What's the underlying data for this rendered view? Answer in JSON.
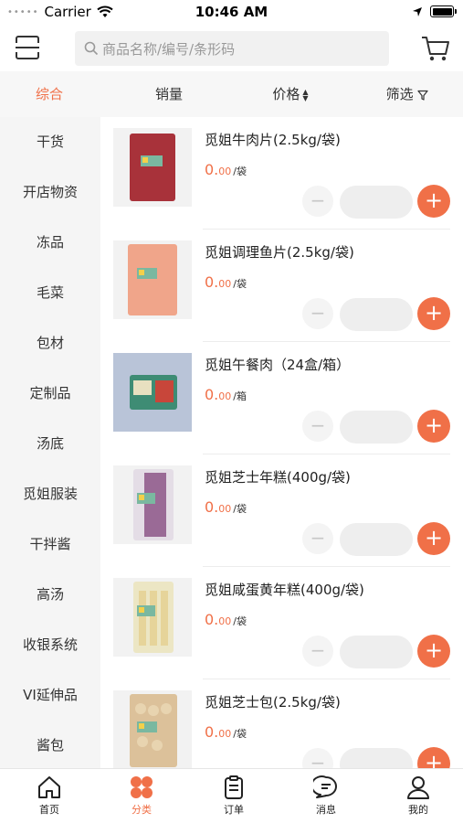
{
  "status_bar": {
    "dots": "•••••",
    "carrier": "Carrier",
    "time": "10:46 AM"
  },
  "search": {
    "placeholder": "商品名称/编号/条形码"
  },
  "sort_bar": {
    "items": [
      {
        "label": "综合"
      },
      {
        "label": "销量"
      },
      {
        "label": "价格"
      },
      {
        "label": "筛选"
      }
    ]
  },
  "categories": [
    {
      "label": "干货"
    },
    {
      "label": "开店物资"
    },
    {
      "label": "冻品"
    },
    {
      "label": "毛菜"
    },
    {
      "label": "包材"
    },
    {
      "label": "定制品"
    },
    {
      "label": "汤底"
    },
    {
      "label": "觅姐服装"
    },
    {
      "label": "干拌酱"
    },
    {
      "label": "高汤"
    },
    {
      "label": "收银系统"
    },
    {
      "label": "VI延伸品"
    },
    {
      "label": "酱包"
    }
  ],
  "products": [
    {
      "name": "觅姐牛肉片(2.5kg/袋)",
      "price_int": "0.",
      "price_dec": "00",
      "unit": "/袋",
      "image_color": "#a8323a"
    },
    {
      "name": "觅姐调理鱼片(2.5kg/袋)",
      "price_int": "0.",
      "price_dec": "00",
      "unit": "/袋",
      "image_color": "#f0a58a"
    },
    {
      "name": "觅姐午餐肉（24盒/箱）",
      "price_int": "0.",
      "price_dec": "00",
      "unit": "/箱",
      "image_color": "#3e8c74"
    },
    {
      "name": "觅姐芝士年糕(400g/袋)",
      "price_int": "0.",
      "price_dec": "00",
      "unit": "/袋",
      "image_color": "#9a6a96"
    },
    {
      "name": "觅姐咸蛋黄年糕(400g/袋)",
      "price_int": "0.",
      "price_dec": "00",
      "unit": "/袋",
      "image_color": "#ece6c4"
    },
    {
      "name": "觅姐芝士包(2.5kg/袋)",
      "price_int": "0.",
      "price_dec": "00",
      "unit": "/袋",
      "image_color": "#dcc19a"
    }
  ],
  "tab_bar": {
    "items": [
      {
        "label": "首页"
      },
      {
        "label": "分类"
      },
      {
        "label": "订单"
      },
      {
        "label": "消息"
      },
      {
        "label": "我的"
      }
    ]
  },
  "colors": {
    "accent": "#f07048"
  }
}
